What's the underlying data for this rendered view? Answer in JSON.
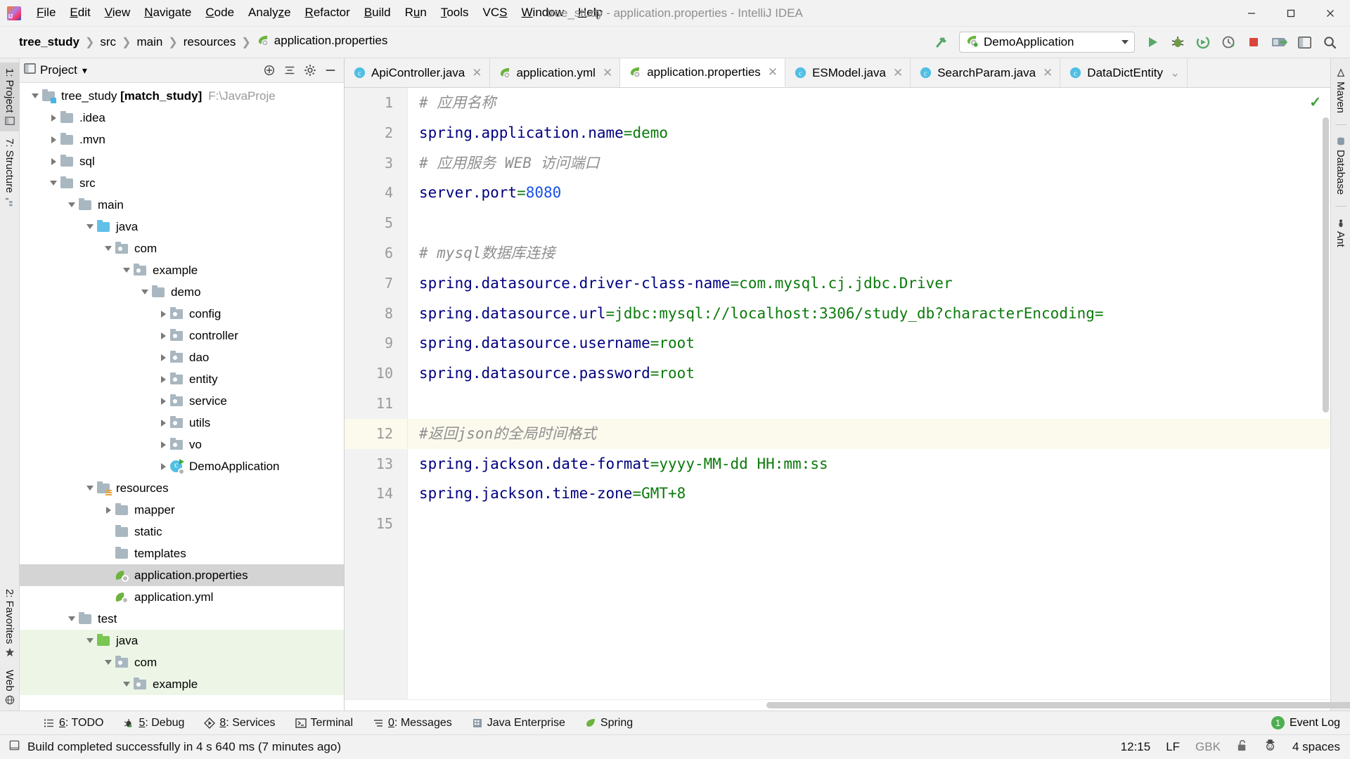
{
  "window": {
    "title": "tree_study - application.properties - IntelliJ IDEA",
    "minimize_label": "—",
    "maximize_label": "▢",
    "close_label": "✕"
  },
  "menubar": {
    "items": [
      {
        "label": "File",
        "mnemonic": "F"
      },
      {
        "label": "Edit",
        "mnemonic": "E"
      },
      {
        "label": "View",
        "mnemonic": "V"
      },
      {
        "label": "Navigate",
        "mnemonic": "N"
      },
      {
        "label": "Code",
        "mnemonic": "C"
      },
      {
        "label": "Analyze",
        "mnemonic": "z"
      },
      {
        "label": "Refactor",
        "mnemonic": "R"
      },
      {
        "label": "Build",
        "mnemonic": "B"
      },
      {
        "label": "Run",
        "mnemonic": "u"
      },
      {
        "label": "Tools",
        "mnemonic": "T"
      },
      {
        "label": "VCS",
        "mnemonic": "S"
      },
      {
        "label": "Window",
        "mnemonic": "W"
      },
      {
        "label": "Help",
        "mnemonic": "H"
      }
    ]
  },
  "navbar": {
    "breadcrumbs": [
      {
        "label": "tree_study",
        "bold": true,
        "icon": ""
      },
      {
        "label": "src",
        "bold": false,
        "icon": ""
      },
      {
        "label": "main",
        "bold": false,
        "icon": ""
      },
      {
        "label": "resources",
        "bold": false,
        "icon": ""
      },
      {
        "label": "application.properties",
        "bold": false,
        "icon": "spring-leaf-icon"
      }
    ],
    "separator": "❯",
    "run_config": {
      "name": "DemoApplication",
      "icon": "spring-leaf-icon"
    },
    "buttons": [
      {
        "name": "build-hammer-button",
        "label": "build"
      },
      {
        "name": "run-button",
        "label": "run"
      },
      {
        "name": "debug-button",
        "label": "debug"
      },
      {
        "name": "run-coverage-button",
        "label": "run with coverage"
      },
      {
        "name": "profiler-button",
        "label": "profiler"
      },
      {
        "name": "stop-button",
        "label": "stop"
      },
      {
        "name": "update-app-button",
        "label": "update application"
      },
      {
        "name": "settings-button",
        "label": "settings"
      },
      {
        "name": "search-everywhere-button",
        "label": "search"
      }
    ]
  },
  "left_strip": {
    "tabs": [
      {
        "label": "1: Project",
        "selected": true,
        "icon": "project-icon"
      },
      {
        "label": "7: Structure",
        "selected": false,
        "icon": "structure-icon"
      },
      {
        "label": "2: Favorites",
        "selected": false,
        "icon": "star-icon"
      },
      {
        "label": "Web",
        "selected": false,
        "icon": "web-icon"
      }
    ]
  },
  "right_strip": {
    "tabs": [
      {
        "label": "Maven",
        "icon": "maven-icon"
      },
      {
        "label": "Database",
        "icon": "database-icon"
      },
      {
        "label": "Ant",
        "icon": "ant-icon"
      }
    ]
  },
  "project_panel": {
    "title": "Project",
    "title_caret": "▾",
    "header_icons": [
      {
        "name": "expand-all-icon",
        "label": "expand"
      },
      {
        "name": "collapse-all-icon",
        "label": "collapse"
      },
      {
        "name": "settings-gear-icon",
        "label": "settings"
      },
      {
        "name": "hide-panel-icon",
        "label": "hide"
      }
    ],
    "tree": [
      {
        "label": "tree_study [match_study]",
        "suffix": "F:\\JavaProje",
        "depth": 0,
        "arrow": "down",
        "icon": "module-folder",
        "bold_part": "[match_study]",
        "selected": false,
        "green": false
      },
      {
        "label": ".idea",
        "suffix": "",
        "depth": 1,
        "arrow": "right",
        "icon": "folder",
        "selected": false,
        "green": false
      },
      {
        "label": ".mvn",
        "suffix": "",
        "depth": 1,
        "arrow": "right",
        "icon": "folder",
        "selected": false,
        "green": false
      },
      {
        "label": "sql",
        "suffix": "",
        "depth": 1,
        "arrow": "right",
        "icon": "folder",
        "selected": false,
        "green": false
      },
      {
        "label": "src",
        "suffix": "",
        "depth": 1,
        "arrow": "down",
        "icon": "folder",
        "selected": false,
        "green": false
      },
      {
        "label": "main",
        "suffix": "",
        "depth": 2,
        "arrow": "down",
        "icon": "folder",
        "selected": false,
        "green": false
      },
      {
        "label": "java",
        "suffix": "",
        "depth": 3,
        "arrow": "down",
        "icon": "folder-blue",
        "selected": false,
        "green": false
      },
      {
        "label": "com",
        "suffix": "",
        "depth": 4,
        "arrow": "down",
        "icon": "package",
        "selected": false,
        "green": false
      },
      {
        "label": "example",
        "suffix": "",
        "depth": 5,
        "arrow": "down",
        "icon": "package",
        "selected": false,
        "green": false
      },
      {
        "label": "demo",
        "suffix": "",
        "depth": 6,
        "arrow": "down",
        "icon": "folder",
        "selected": false,
        "green": false
      },
      {
        "label": "config",
        "suffix": "",
        "depth": 7,
        "arrow": "right",
        "icon": "package",
        "selected": false,
        "green": false
      },
      {
        "label": "controller",
        "suffix": "",
        "depth": 7,
        "arrow": "right",
        "icon": "package",
        "selected": false,
        "green": false
      },
      {
        "label": "dao",
        "suffix": "",
        "depth": 7,
        "arrow": "right",
        "icon": "package",
        "selected": false,
        "green": false
      },
      {
        "label": "entity",
        "suffix": "",
        "depth": 7,
        "arrow": "right",
        "icon": "package",
        "selected": false,
        "green": false
      },
      {
        "label": "service",
        "suffix": "",
        "depth": 7,
        "arrow": "right",
        "icon": "package",
        "selected": false,
        "green": false
      },
      {
        "label": "utils",
        "suffix": "",
        "depth": 7,
        "arrow": "right",
        "icon": "package",
        "selected": false,
        "green": false
      },
      {
        "label": "vo",
        "suffix": "",
        "depth": 7,
        "arrow": "right",
        "icon": "package",
        "selected": false,
        "green": false
      },
      {
        "label": "DemoApplication",
        "suffix": "",
        "depth": 7,
        "arrow": "right",
        "icon": "class-run",
        "selected": false,
        "green": false
      },
      {
        "label": "resources",
        "suffix": "",
        "depth": 3,
        "arrow": "down",
        "icon": "folder-resources",
        "selected": false,
        "green": false
      },
      {
        "label": "mapper",
        "suffix": "",
        "depth": 4,
        "arrow": "right",
        "icon": "folder",
        "selected": false,
        "green": false
      },
      {
        "label": "static",
        "suffix": "",
        "depth": 4,
        "arrow": "none",
        "icon": "folder",
        "selected": false,
        "green": false
      },
      {
        "label": "templates",
        "suffix": "",
        "depth": 4,
        "arrow": "none",
        "icon": "folder",
        "selected": false,
        "green": false
      },
      {
        "label": "application.properties",
        "suffix": "",
        "depth": 4,
        "arrow": "none",
        "icon": "spring-leaf",
        "selected": true,
        "green": false
      },
      {
        "label": "application.yml",
        "suffix": "",
        "depth": 4,
        "arrow": "none",
        "icon": "spring-leaf",
        "selected": false,
        "green": false
      },
      {
        "label": "test",
        "suffix": "",
        "depth": 2,
        "arrow": "down",
        "icon": "folder",
        "selected": false,
        "green": false
      },
      {
        "label": "java",
        "suffix": "",
        "depth": 3,
        "arrow": "down",
        "icon": "folder-green",
        "selected": false,
        "green": true
      },
      {
        "label": "com",
        "suffix": "",
        "depth": 4,
        "arrow": "down",
        "icon": "package",
        "selected": false,
        "green": true
      },
      {
        "label": "example",
        "suffix": "",
        "depth": 5,
        "arrow": "down",
        "icon": "package",
        "selected": false,
        "green": true
      }
    ]
  },
  "editor": {
    "tabs": [
      {
        "label": "ApiController.java",
        "icon": "java-class-icon",
        "active": false,
        "closable": true
      },
      {
        "label": "application.yml",
        "icon": "spring-leaf-icon",
        "active": false,
        "closable": true
      },
      {
        "label": "application.properties",
        "icon": "spring-leaf-icon",
        "active": true,
        "closable": true
      },
      {
        "label": "ESModel.java",
        "icon": "java-class-icon",
        "active": false,
        "closable": true
      },
      {
        "label": "SearchParam.java",
        "icon": "java-class-icon",
        "active": false,
        "closable": true
      },
      {
        "label": "DataDictEntity",
        "icon": "java-class-icon",
        "active": false,
        "closable": false
      }
    ],
    "tab_overflow_chevron": "⌄",
    "inspection_ok_mark": "✓",
    "current_line": 12,
    "lines": [
      {
        "n": 1,
        "segments": [
          {
            "t": "# 应用名称",
            "c": "cmt"
          }
        ]
      },
      {
        "n": 2,
        "segments": [
          {
            "t": "spring.application.name",
            "c": "key"
          },
          {
            "t": "=",
            "c": "eq"
          },
          {
            "t": "demo",
            "c": "val"
          }
        ]
      },
      {
        "n": 3,
        "segments": [
          {
            "t": "# 应用服务 WEB 访问端口",
            "c": "cmt"
          }
        ]
      },
      {
        "n": 4,
        "segments": [
          {
            "t": "server.port",
            "c": "key"
          },
          {
            "t": "=",
            "c": "eq"
          },
          {
            "t": "8080",
            "c": "num"
          }
        ]
      },
      {
        "n": 5,
        "segments": []
      },
      {
        "n": 6,
        "segments": [
          {
            "t": "# mysql数据库连接",
            "c": "cmt"
          }
        ]
      },
      {
        "n": 7,
        "segments": [
          {
            "t": "spring.datasource.driver-class-name",
            "c": "key"
          },
          {
            "t": "=",
            "c": "eq"
          },
          {
            "t": "com.mysql.cj.jdbc.Driver",
            "c": "val"
          }
        ]
      },
      {
        "n": 8,
        "segments": [
          {
            "t": "spring.datasource.url",
            "c": "key"
          },
          {
            "t": "=",
            "c": "eq"
          },
          {
            "t": "jdbc:mysql://localhost:3306/study_db?characterEncoding=",
            "c": "val"
          }
        ]
      },
      {
        "n": 9,
        "segments": [
          {
            "t": "spring.datasource.username",
            "c": "key"
          },
          {
            "t": "=",
            "c": "eq"
          },
          {
            "t": "root",
            "c": "val"
          }
        ]
      },
      {
        "n": 10,
        "segments": [
          {
            "t": "spring.datasource.password",
            "c": "key"
          },
          {
            "t": "=",
            "c": "eq"
          },
          {
            "t": "root",
            "c": "val"
          }
        ]
      },
      {
        "n": 11,
        "segments": []
      },
      {
        "n": 12,
        "segments": [
          {
            "t": "#返回json的全局时间格式",
            "c": "cmt"
          }
        ]
      },
      {
        "n": 13,
        "segments": [
          {
            "t": "spring.jackson.date-format",
            "c": "key"
          },
          {
            "t": "=",
            "c": "eq"
          },
          {
            "t": "yyyy-MM-dd HH:mm:ss",
            "c": "val"
          }
        ]
      },
      {
        "n": 14,
        "segments": [
          {
            "t": "spring.jackson.time-zone",
            "c": "key"
          },
          {
            "t": "=",
            "c": "eq"
          },
          {
            "t": "GMT+8",
            "c": "val"
          }
        ]
      },
      {
        "n": 15,
        "segments": []
      }
    ]
  },
  "tool_windows": {
    "items": [
      {
        "label": "6: TODO",
        "mnemonic": "6",
        "icon": "todo-icon"
      },
      {
        "label": "5: Debug",
        "mnemonic": "5",
        "icon": "debug-bug-icon"
      },
      {
        "label": "8: Services",
        "mnemonic": "8",
        "icon": "services-play-icon"
      },
      {
        "label": "Terminal",
        "mnemonic": "",
        "icon": "terminal-icon"
      },
      {
        "label": "0: Messages",
        "mnemonic": "0",
        "icon": "messages-icon"
      },
      {
        "label": "Java Enterprise",
        "mnemonic": "",
        "icon": "java-enterprise-icon"
      },
      {
        "label": "Spring",
        "mnemonic": "",
        "icon": "spring-leaf-icon"
      }
    ],
    "event_log": {
      "label": "Event Log",
      "badge": "1",
      "badge_color": "#4caf50"
    }
  },
  "statusbar": {
    "message": "Build completed successfully in 4 s 640 ms (7 minutes ago)",
    "message_icon": "build-icon",
    "position": "12:15",
    "line_separator": "LF",
    "encoding": "GBK",
    "lock_icon": "unlocked-padlock-icon",
    "profile_icon": "inspection-hector-icon",
    "indent": "4 spaces"
  }
}
